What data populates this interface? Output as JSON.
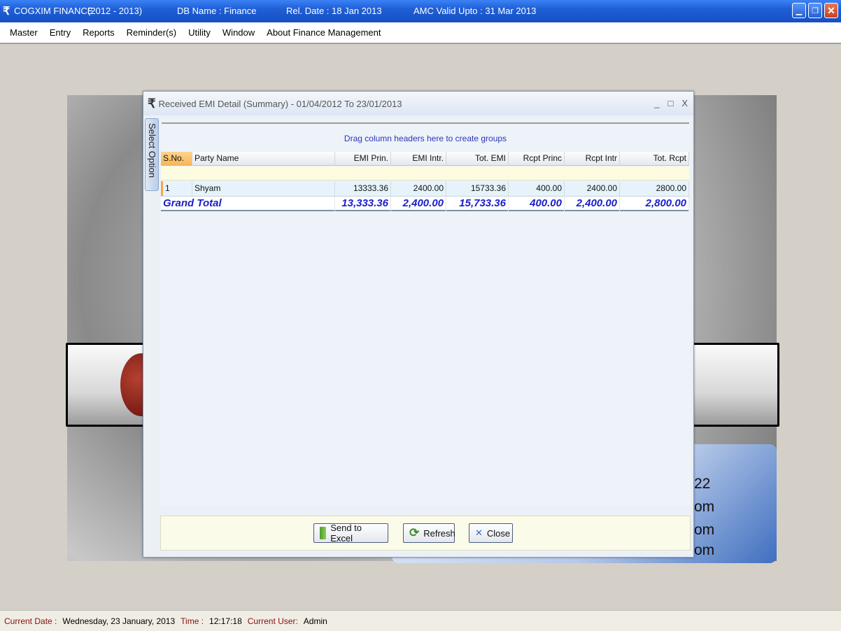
{
  "titlebar": {
    "app": "COGXIM FINANCE",
    "year": "(2012 - 2013)",
    "db": "DB Name : Finance",
    "rel": "Rel. Date : 18 Jan 2013",
    "amc": "AMC Valid Upto : 31 Mar 2013",
    "logo": "₹",
    "min_icon": "minimize-icon",
    "restore_icon": "restore-icon",
    "close_icon": "close-icon"
  },
  "menu": [
    "Master",
    "Entry",
    "Reports",
    "Reminder(s)",
    "Utility",
    "Window",
    "About Finance Management"
  ],
  "background": {
    "lines": [
      "22",
      "om",
      "om",
      "om"
    ]
  },
  "dialog": {
    "title": "Received EMI Detail (Summary) - 01/04/2012 To 23/01/2013",
    "rupee": "₹",
    "ctrl_min": "_",
    "ctrl_max": "□",
    "ctrl_close": "X",
    "side_tab": "Select Option",
    "group_hint": "Drag column headers here to create groups",
    "columns": [
      "S.No.",
      "Party Name",
      "EMI Prin.",
      "EMI Intr.",
      "Tot. EMI",
      "Rcpt Princ",
      "Rcpt Intr",
      "Tot. Rcpt"
    ],
    "rows": [
      [
        "1",
        "Shyam",
        "13333.36",
        "2400.00",
        "15733.36",
        "400.00",
        "2400.00",
        "2800.00"
      ]
    ],
    "total": [
      "Grand Total",
      "13,333.36",
      "2,400.00",
      "15,733.36",
      "400.00",
      "2,400.00",
      "2,800.00"
    ],
    "buttons": {
      "excel": "Send to Excel",
      "refresh": "Refresh",
      "close": "Close"
    }
  },
  "status": {
    "date_label": "Current Date :",
    "date": "Wednesday, 23 January, 2013",
    "time_label": "Time :",
    "time": "12:17:18",
    "user_label": "Current User:",
    "user": "Admin"
  }
}
